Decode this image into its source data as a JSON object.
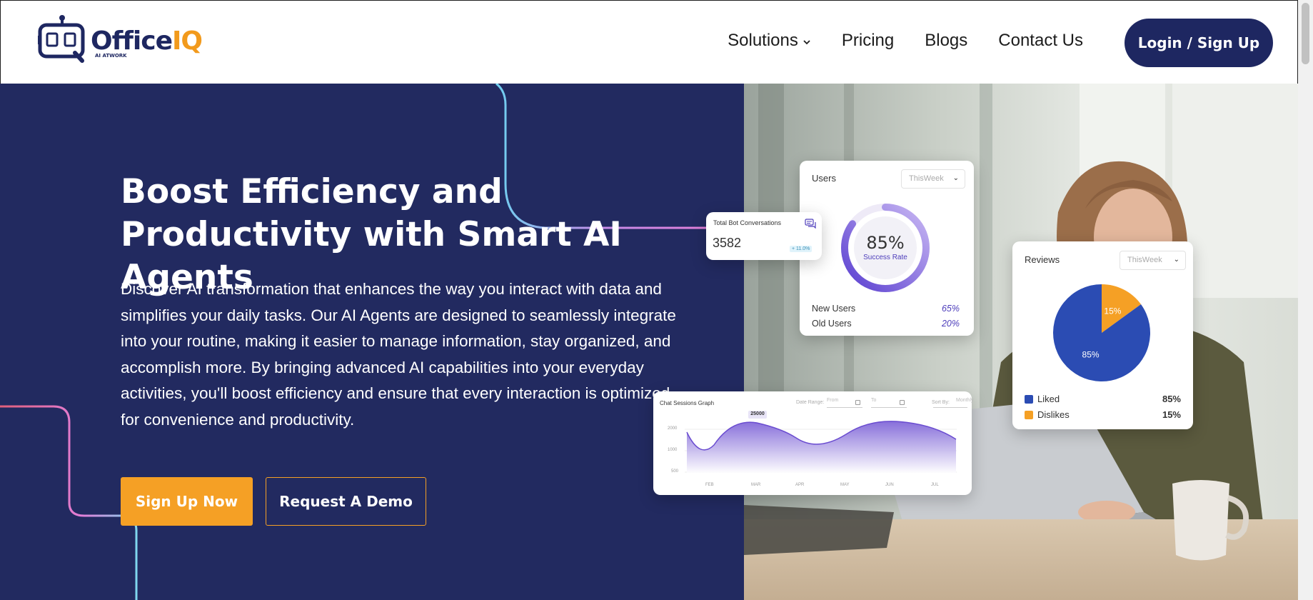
{
  "logo": {
    "brand_main": "Office",
    "brand_accent": "IQ",
    "tagline": "AI ATWORK"
  },
  "nav": {
    "links": [
      {
        "label": "Solutions",
        "has_dropdown": true
      },
      {
        "label": "Pricing"
      },
      {
        "label": "Blogs"
      },
      {
        "label": "Contact Us"
      }
    ],
    "login_label": "Login / Sign Up"
  },
  "hero": {
    "title": "Boost Efficiency and Productivity with Smart AI Agents",
    "description": "Discover AI transformation that enhances the way you interact with data and simplifies your daily tasks. Our AI Agents are designed to seamlessly integrate into your routine, making it easier to manage information, stay organized, and accomplish more. By bringing advanced AI capabilities into your everyday activities, you'll boost efficiency and ensure that every interaction is optimized for convenience and productivity.",
    "primary_cta": "Sign Up Now",
    "secondary_cta": "Request A Demo"
  },
  "users_card": {
    "title": "Users",
    "period": "ThisWeek",
    "success_rate": "85%",
    "success_label": "Success Rate",
    "success_fraction": 0.85,
    "rows": [
      {
        "label": "New Users",
        "value": "65%"
      },
      {
        "label": "Old Users",
        "value": "20%"
      }
    ]
  },
  "reviews_card": {
    "title": "Reviews",
    "period": "ThisWeek",
    "slices": [
      {
        "label": "Liked",
        "value": "85%",
        "pct": 85,
        "color": "#2b4cb3"
      },
      {
        "label": "Dislikes",
        "value": "15%",
        "pct": 15,
        "color": "#f5a025"
      }
    ]
  },
  "bot_card": {
    "title": "Total Bot Conversations",
    "value": "3582",
    "badge": "+ 11.0%"
  },
  "graph_card": {
    "title": "Chat Sessions Graph",
    "date_range_label": "Date Range:",
    "from_placeholder": "From",
    "to_placeholder": "To",
    "sort_label": "Sort By:",
    "sort_value": "Monthly",
    "peak_label": "25000",
    "y_ticks": [
      "2000",
      "1000",
      "500"
    ],
    "x_ticks": [
      "FEB",
      "MAR",
      "APR",
      "MAY",
      "JUN",
      "JUL"
    ]
  },
  "colors": {
    "navy": "#222a60",
    "brand_navy": "#1e2761",
    "orange": "#f5a025",
    "purple": "#6a4cd0"
  }
}
